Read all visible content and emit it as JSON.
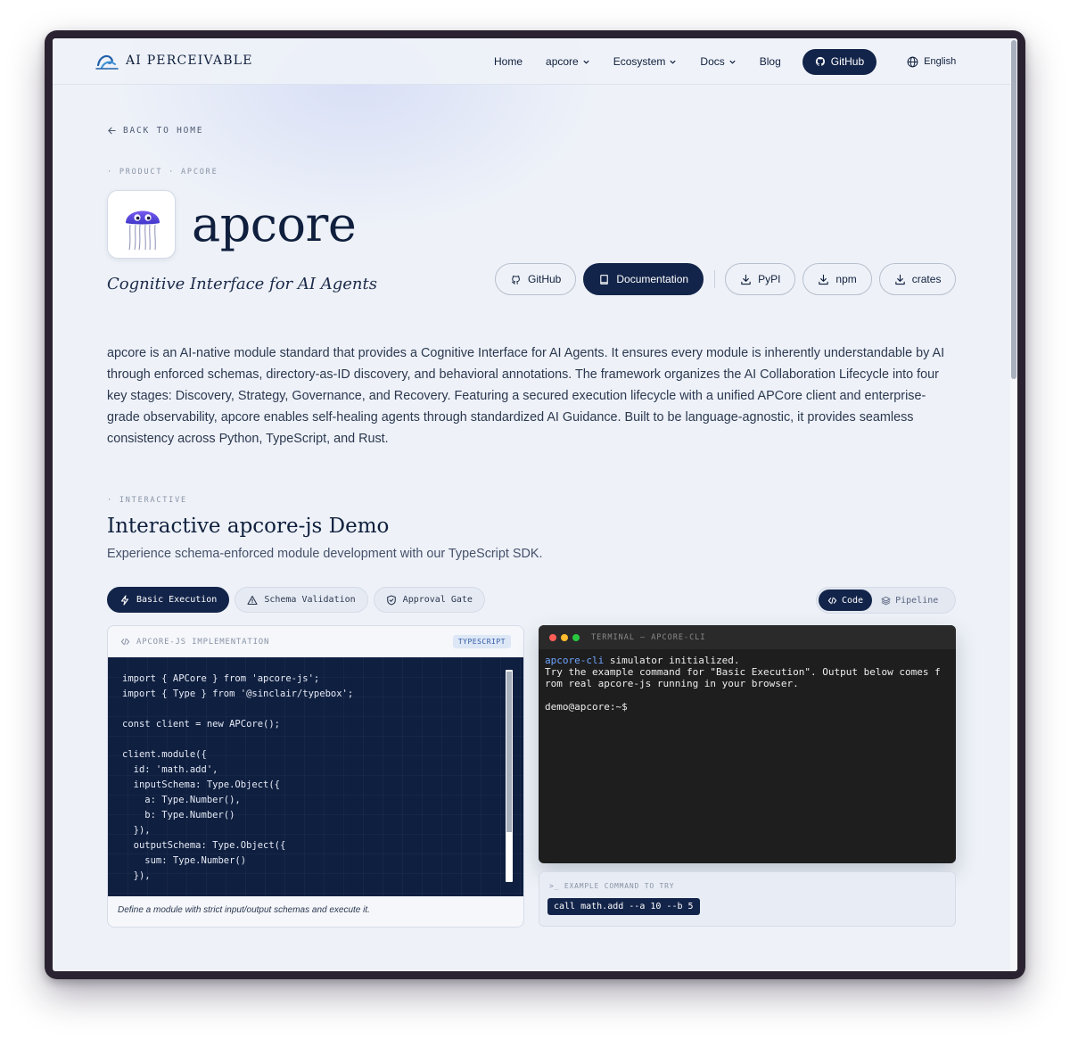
{
  "nav": {
    "brand": "AI PERCEIVABLE",
    "links": [
      {
        "label": "Home"
      },
      {
        "label": "apcore"
      },
      {
        "label": "Ecosystem"
      },
      {
        "label": "Docs"
      },
      {
        "label": "Blog"
      }
    ],
    "github_label": "GitHub",
    "language": "English"
  },
  "hero": {
    "back_label": "BACK TO HOME",
    "breadcrumb": "· PRODUCT · APCORE",
    "title": "apcore",
    "tagline": "Cognitive Interface for AI Agents",
    "buttons": {
      "github": "GitHub",
      "docs": "Documentation",
      "pypi": "PyPI",
      "npm": "npm",
      "crates": "crates"
    },
    "description": "apcore is an AI-native module standard that provides a Cognitive Interface for AI Agents. It ensures every module is inherently understandable by AI through enforced schemas, directory-as-ID discovery, and behavioral annotations. The framework organizes the AI Collaboration Lifecycle into four key stages: Discovery, Strategy, Governance, and Recovery. Featuring a secured execution lifecycle with a unified APCore client and enterprise-grade observability, apcore enables self-healing agents through standardized AI Guidance. Built to be language-agnostic, it provides seamless consistency across Python, TypeScript, and Rust."
  },
  "demo": {
    "section_label": "· INTERACTIVE",
    "title": "Interactive apcore-js Demo",
    "subtitle": "Experience schema-enforced module development with our TypeScript SDK.",
    "tabs": {
      "basic": "Basic Execution",
      "schema": "Schema Validation",
      "approval": "Approval Gate"
    },
    "view_toggle": {
      "code": "Code",
      "pipeline": "Pipeline"
    },
    "code_panel": {
      "header": "APCORE-JS IMPLEMENTATION",
      "badge": "TYPESCRIPT",
      "code": "import { APCore } from 'apcore-js';\nimport { Type } from '@sinclair/typebox';\n\nconst client = new APCore();\n\nclient.module({\n  id: 'math.add',\n  inputSchema: Type.Object({\n    a: Type.Number(),\n    b: Type.Number()\n  }),\n  outputSchema: Type.Object({\n    sum: Type.Number()\n  }),",
      "caption": "Define a module with strict input/output schemas and execute it."
    },
    "terminal": {
      "title": "TERMINAL — APCORE-CLI",
      "cli_name": "apcore-cli",
      "init_text": " simulator initialized.",
      "line2": "Try the example command for \"Basic Execution\". Output below comes f",
      "line3": "rom real apcore-js running in your browser.",
      "prompt": "demo@apcore:~$"
    },
    "example": {
      "label": ">_  EXAMPLE COMMAND TO TRY",
      "command": "call math.add --a 10 --b 5"
    }
  },
  "colors": {
    "navy": "#13244a",
    "background": "#eef2f8",
    "terminal_bg": "#1e1e1e",
    "cli_accent": "#6fa4ff"
  }
}
